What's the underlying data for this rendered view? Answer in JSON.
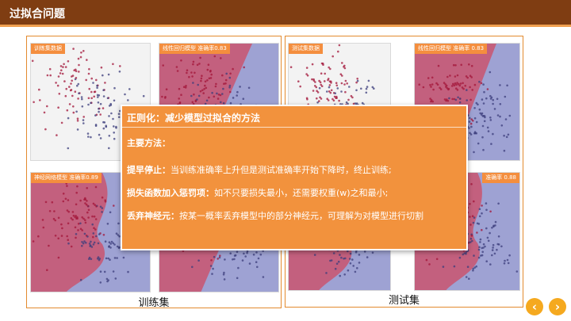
{
  "header": {
    "title": "过拟合问题"
  },
  "panels": {
    "train": {
      "caption": "训练集",
      "plots": {
        "data": "训练集数据",
        "linear": "线性回归模型 准确率0.83",
        "nn": "神经网络模型 准确率0.89"
      }
    },
    "test": {
      "caption": "测试集",
      "plots": {
        "data": "测试集数据",
        "linear": "线性回归模型 准确率 0.83",
        "nn": "准确率 0.88"
      }
    }
  },
  "overlay": {
    "heading": "正则化：减少模型过拟合的方法",
    "subheading": "主要方法：",
    "methods": [
      {
        "term": "提早停止：",
        "desc": "当训练准确率上升但是测试准确率开始下降时，终止训练;"
      },
      {
        "term": "损失函数加入惩罚项：",
        "desc": "如不只要损失最小，还需要权重(w)之和最小;"
      },
      {
        "term": "丢弃神经元：",
        "desc": "按某一概率丢弃模型中的部分神经元，可理解为对模型进行切割"
      }
    ]
  },
  "nav": {
    "prev_icon": "chevron-left-icon",
    "next_icon": "chevron-right-icon"
  },
  "colors": {
    "accent": "#f2923d",
    "header_bg": "#7f3d12",
    "border": "#e38a2e",
    "region_red": "#c9556f",
    "region_blue": "#8e93cc",
    "point_red": "#a3163a",
    "point_blue": "#3c3d7c"
  }
}
